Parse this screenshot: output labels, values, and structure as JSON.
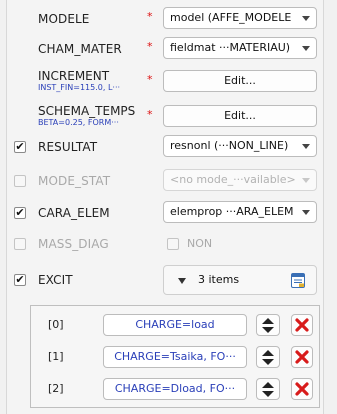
{
  "rows": {
    "modele": {
      "label": "MODELE",
      "value": "model (AFFE_MODELE"
    },
    "cham_mater": {
      "label": "CHAM_MATER",
      "value": "fieldmat ···MATERIAU)"
    },
    "increment": {
      "label": "INCREMENT",
      "sub": "INST_FIN=115.0, L···",
      "button": "Edit..."
    },
    "schema_temps": {
      "label": "SCHEMA_TEMPS",
      "sub": "BETA=0.25, FORM···",
      "button": "Edit..."
    },
    "resultat": {
      "label": "RESULTAT",
      "checked": true,
      "value": "resnonl (···NON_LINE)"
    },
    "mode_stat": {
      "label": "MODE_STAT",
      "checked": false,
      "value": "<no mode_···vailable>"
    },
    "cara_elem": {
      "label": "CARA_ELEM",
      "checked": true,
      "value": "elemprop ···ARA_ELEM"
    },
    "mass_diag": {
      "label": "MASS_DIAG",
      "checked": false,
      "option": "NON"
    },
    "excit": {
      "label": "EXCIT",
      "checked": true,
      "count": "3 items"
    }
  },
  "required_mark": "*",
  "check_glyph": "✔",
  "excit_items": [
    {
      "index": "[0]",
      "value": "CHARGE=load"
    },
    {
      "index": "[1]",
      "value": "CHARGE=Tsaika, FO···"
    },
    {
      "index": "[2]",
      "value": "CHARGE=Dload, FO···"
    }
  ],
  "colors": {
    "link_blue": "#2a3fb8",
    "required_red": "#dd1111",
    "delete_red": "#d81b1b"
  }
}
